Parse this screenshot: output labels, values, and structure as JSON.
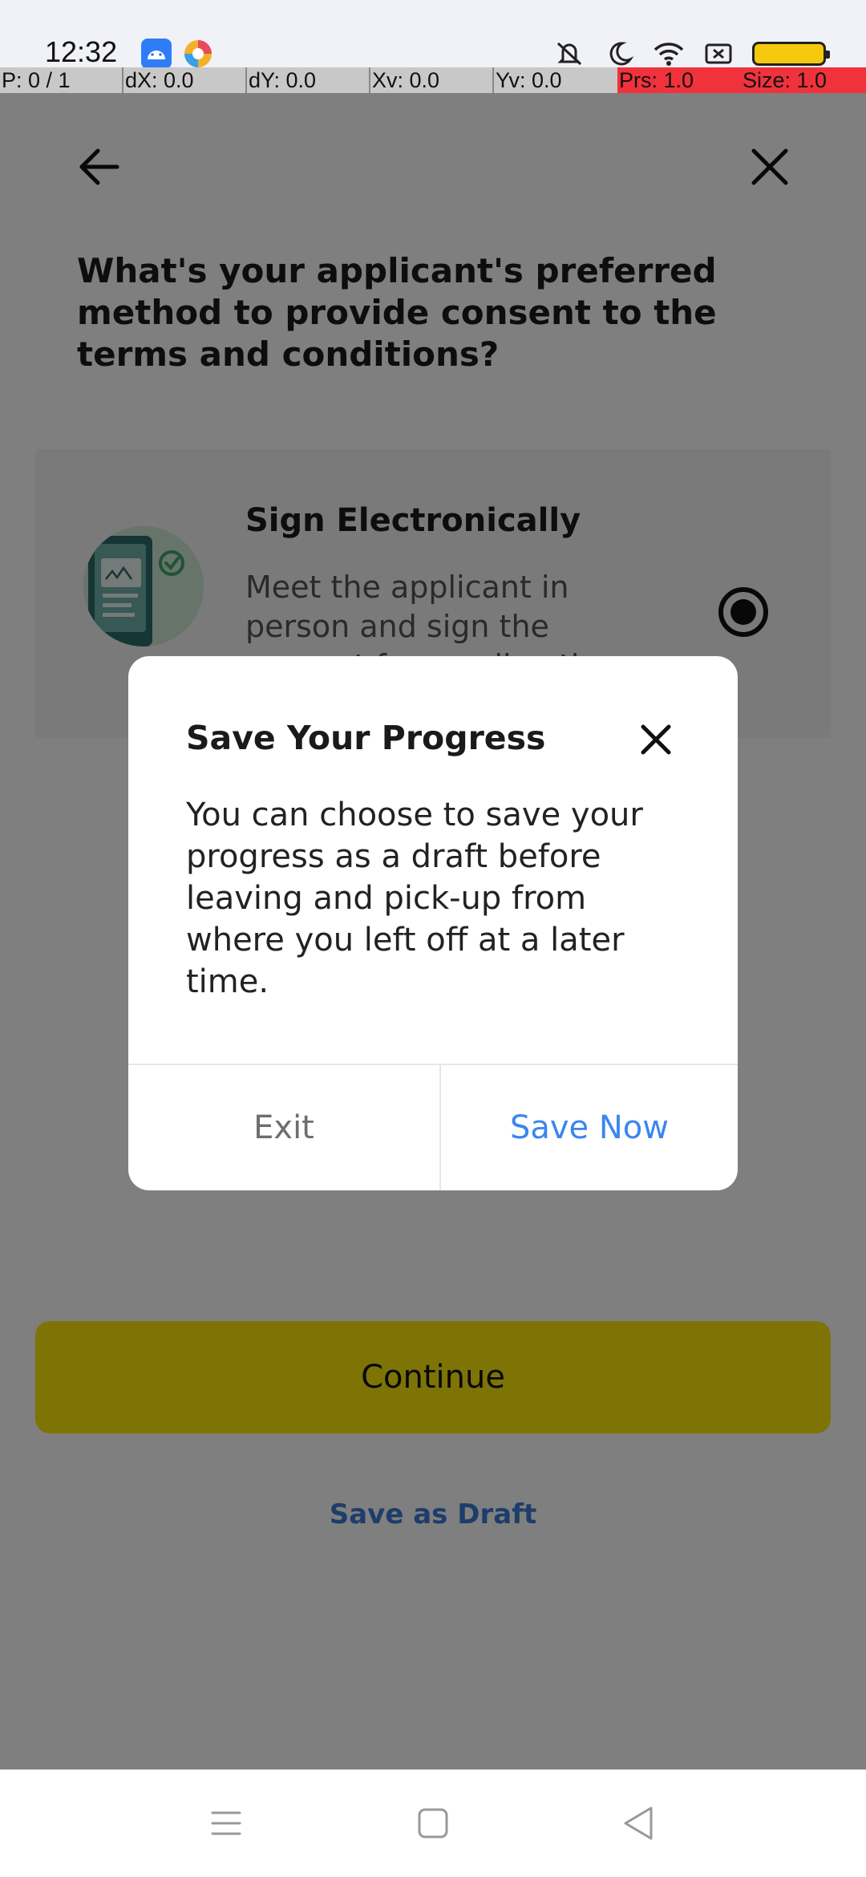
{
  "status_bar": {
    "time": "12:32",
    "left_icons": [
      "android-app-icon",
      "colorful-app-icon"
    ],
    "right_icons": [
      "silent-icon",
      "moon-icon",
      "wifi-icon",
      "x-box-icon",
      "battery-icon"
    ]
  },
  "pointer_overlay": {
    "p": "P: 0 / 1",
    "dx": "dX: 0.0",
    "dy": "dY: 0.0",
    "xv": "Xv: 0.0",
    "yv": "Yv: 0.0",
    "prs": "Prs: 1.0",
    "size": "Size: 1.0"
  },
  "header": {
    "back_icon": "arrow-left-icon",
    "close_icon": "close-icon"
  },
  "question": "What's your applicant's preferred method to provide consent to the terms and conditions?",
  "option": {
    "title": "Sign Electronically",
    "description": "Meet the applicant in person and sign the consent form online th",
    "selected": true
  },
  "continue_label": "Continue",
  "save_as_draft_label": "Save as Draft",
  "dialog": {
    "title": "Save Your Progress",
    "body": "You can choose to save your progress as a draft before leaving and pick-up from where you left off at a later time.",
    "exit_label": "Exit",
    "save_now_label": "Save Now"
  },
  "colors": {
    "accent_blue": "#3a86f0",
    "continue_yellow": "#fde70a",
    "scrim": "rgba(0,0,0,0.5)"
  },
  "nav_bar": {
    "icons": [
      "menu-icon",
      "home-square-icon",
      "back-triangle-icon"
    ]
  }
}
